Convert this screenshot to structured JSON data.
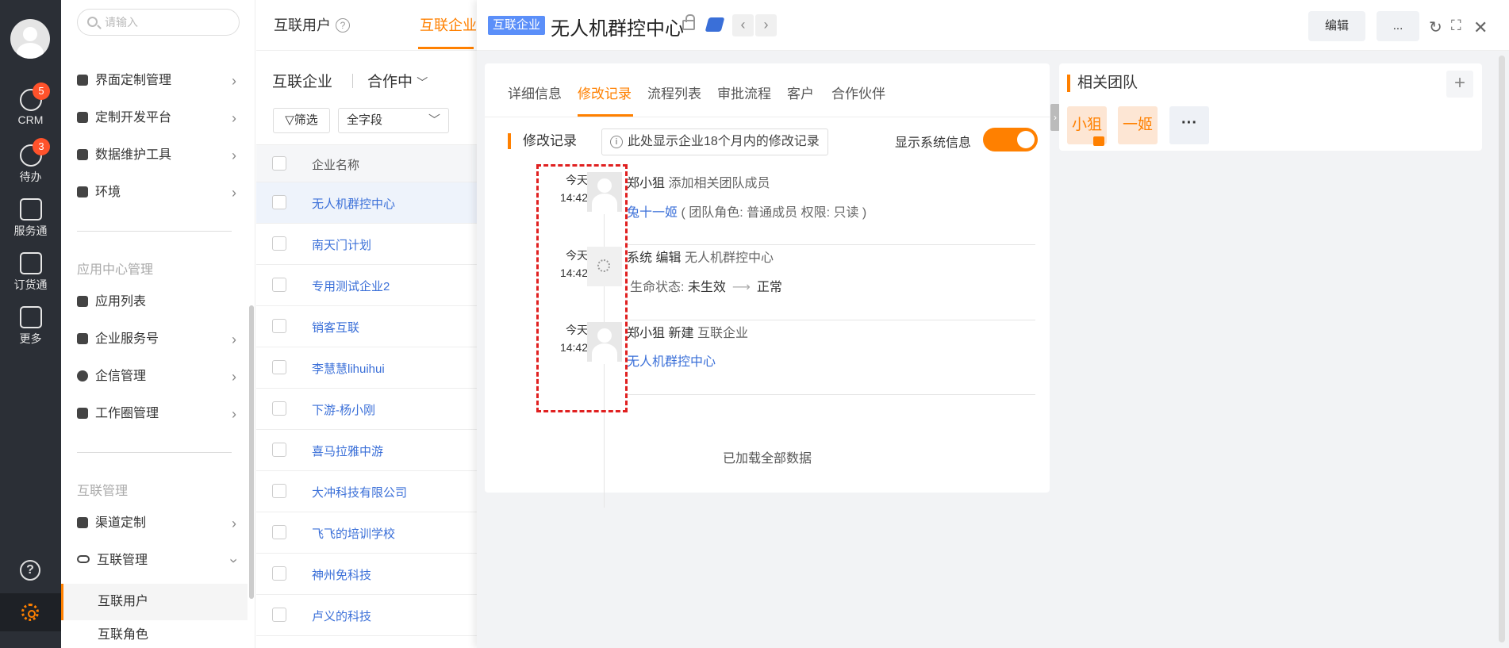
{
  "rail": {
    "items": [
      {
        "label": "CRM",
        "icon": "clock-icon",
        "badge": "5"
      },
      {
        "label": "待办",
        "icon": "check-circle-icon",
        "badge": "3"
      },
      {
        "label": "服务通",
        "icon": "service-icon",
        "badge": ""
      },
      {
        "label": "订货通",
        "icon": "order-icon",
        "badge": ""
      },
      {
        "label": "更多",
        "icon": "grid-icon",
        "badge": ""
      }
    ],
    "help_icon": "?",
    "accent": "#ff8000"
  },
  "sidebar": {
    "search_placeholder": "请输入",
    "items_top": [
      {
        "label": "界面定制管理"
      },
      {
        "label": "定制开发平台"
      },
      {
        "label": "数据维护工具"
      },
      {
        "label": "环境"
      }
    ],
    "group_app": "应用中心管理",
    "items_app": [
      {
        "label": "应用列表"
      },
      {
        "label": "企业服务号"
      },
      {
        "label": "企信管理"
      },
      {
        "label": "工作圈管理"
      }
    ],
    "group_interconnect": "互联管理",
    "items_interconnect": [
      {
        "label": "渠道定制"
      },
      {
        "label": "互联管理"
      }
    ],
    "sub_items": [
      {
        "label": "互联用户"
      },
      {
        "label": "互联角色"
      }
    ]
  },
  "list": {
    "tabs": [
      {
        "label": "互联用户"
      },
      {
        "label": "互联企业"
      }
    ],
    "view_label": "互联企业",
    "status_label": "合作中",
    "filter_label": "筛选",
    "field_select": "全字段",
    "column_header": "企业名称",
    "rows": [
      {
        "name": "无人机群控中心"
      },
      {
        "name": "南天门计划"
      },
      {
        "name": "专用测试企业2"
      },
      {
        "name": "销客互联"
      },
      {
        "name": "李慧慧lihuihui"
      },
      {
        "name": "下游-杨小刚"
      },
      {
        "name": "喜马拉雅中游"
      },
      {
        "name": "大冲科技有限公司"
      },
      {
        "name": "飞飞的培训学校"
      },
      {
        "name": "神州免科技"
      },
      {
        "name": "卢义的科技"
      }
    ]
  },
  "detail": {
    "tag": "互联企业",
    "title": "无人机群控中心",
    "edit_button": "编辑",
    "more_button": "...",
    "tabs": [
      {
        "label": "详细信息"
      },
      {
        "label": "修改记录"
      },
      {
        "label": "流程列表"
      },
      {
        "label": "审批流程"
      },
      {
        "label": "客户"
      },
      {
        "label": "合作伙伴"
      }
    ],
    "section_title": "修改记录",
    "notice": "此处显示企业18个月内的修改记录",
    "toggle_label": "显示系统信息",
    "toggle_on": true,
    "records": [
      {
        "day": "今天",
        "time": "14:42",
        "actor": "郑小狙",
        "action": "添加相关团队成员",
        "detail_link": "兔十一姬",
        "detail_rest": "( 团队角色: 普通成员  权限: 只读 )"
      },
      {
        "day": "今天",
        "time": "14:42",
        "actor": "系统",
        "action_verb": "编辑",
        "action": "无人机群控中心",
        "field": "生命状态:",
        "from": "未生效",
        "to": "正常"
      },
      {
        "day": "今天",
        "time": "14:42",
        "actor": "郑小狙",
        "action_verb": "新建",
        "action": "互联企业",
        "detail_link": "无人机群控中心"
      }
    ],
    "loaded_text": "已加载全部数据",
    "team": {
      "title": "相关团队",
      "members": [
        {
          "label": "小狙"
        },
        {
          "label": "一姬"
        }
      ],
      "more": "···",
      "add": "+"
    }
  }
}
